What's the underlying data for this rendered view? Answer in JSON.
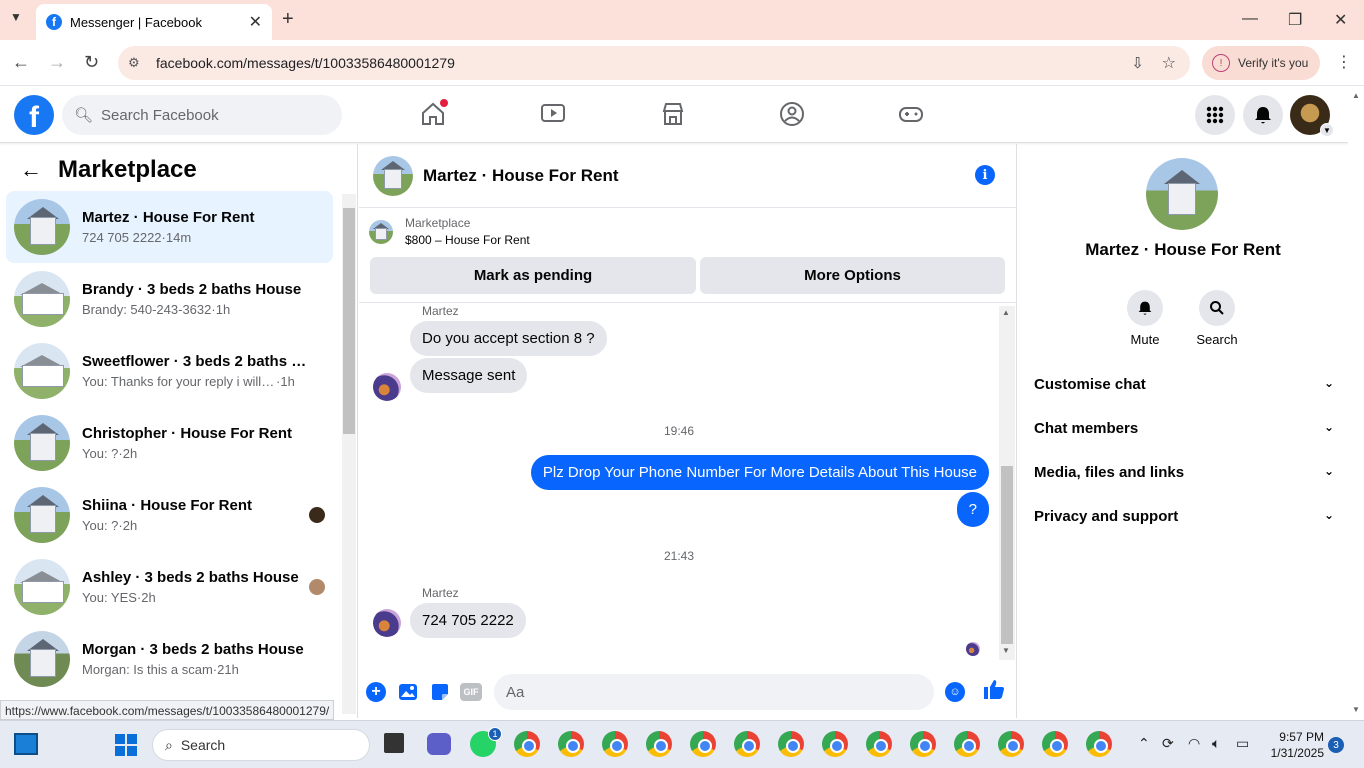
{
  "browser": {
    "tab_title": "Messenger | Facebook",
    "url": "facebook.com/messages/t/10033586480001279",
    "verify_label": "Verify it's you",
    "status_url": "https://www.facebook.com/messages/t/10033586480001279/"
  },
  "fb_header": {
    "search_placeholder": "Search Facebook"
  },
  "left_panel": {
    "title": "Marketplace",
    "conversations": [
      {
        "name": "Martez · House For Rent",
        "preview": "724 705 2222",
        "time": "14m",
        "thumb": "house"
      },
      {
        "name": "Brandy · 3 beds 2 baths House",
        "preview": "Brandy: 540-243-3632",
        "time": "1h",
        "thumb": "white-house"
      },
      {
        "name": "Sweetflower · 3 beds 2 baths Ho...",
        "preview": "You: Thanks for your reply i will co...",
        "time": "1h",
        "thumb": "white-house"
      },
      {
        "name": "Christopher · House For Rent",
        "preview": "You: ?",
        "time": "2h",
        "thumb": "house"
      },
      {
        "name": "Shiina · House For Rent",
        "preview": "You: ?",
        "time": "2h",
        "thumb": "house"
      },
      {
        "name": "Ashley · 3 beds 2 baths House",
        "preview": "You: YES",
        "time": "2h",
        "thumb": "white-house"
      },
      {
        "name": "Morgan · 3 beds 2 baths House",
        "preview": "Morgan: Is this a scam",
        "time": "21h",
        "thumb": "scenic"
      }
    ]
  },
  "chat": {
    "title": "Martez · House For Rent",
    "marketplace_label": "Marketplace",
    "listing": "$800 – House For Rent",
    "mark_pending": "Mark as pending",
    "more_options": "More Options",
    "messages": {
      "sender1": "Martez",
      "m1": "Do you accept section 8 ?",
      "m2": "Message sent",
      "time1": "19:46",
      "out1": "Plz Drop Your Phone Number For More Details About This House",
      "out2": "?",
      "time2": "21:43",
      "sender2": "Martez",
      "m3": "724 705 2222"
    },
    "input_placeholder": "Aa"
  },
  "right_panel": {
    "name": "Martez · House For Rent",
    "mute": "Mute",
    "search": "Search",
    "sections": [
      "Customise chat",
      "Chat members",
      "Media, files and links",
      "Privacy and support"
    ]
  },
  "taskbar": {
    "search": "Search",
    "time": "9:57 PM",
    "date": "1/31/2025",
    "notif_count": "3",
    "whatsapp_badge": "1"
  },
  "colors": {
    "messenger_blue": "#0866ff",
    "fb_blue": "#1877f2",
    "active_row": "#e7f3ff"
  }
}
